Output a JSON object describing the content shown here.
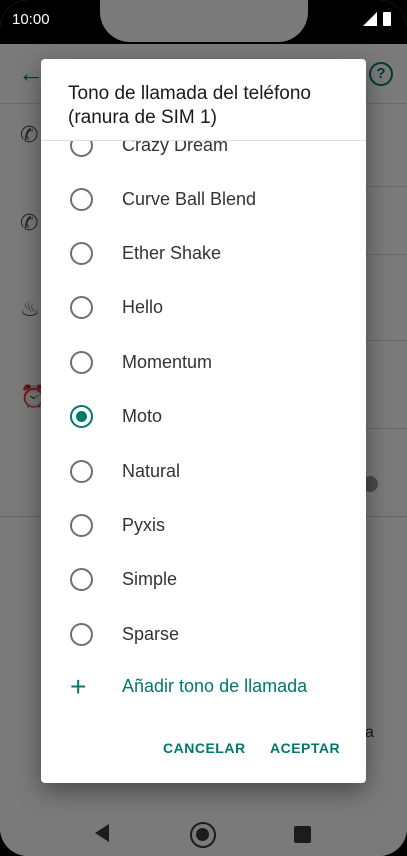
{
  "status_bar": {
    "time": "10:00"
  },
  "background_app": {
    "help_icon_text": "?",
    "trailing_text": "a"
  },
  "dialog": {
    "title": "Tono de llamada del teléfono (ranura de SIM 1)",
    "options": [
      {
        "label": "Crazy Dream",
        "checked": false
      },
      {
        "label": "Curve Ball Blend",
        "checked": false
      },
      {
        "label": "Ether Shake",
        "checked": false
      },
      {
        "label": "Hello",
        "checked": false
      },
      {
        "label": "Momentum",
        "checked": false
      },
      {
        "label": "Moto",
        "checked": true
      },
      {
        "label": "Natural",
        "checked": false
      },
      {
        "label": "Pyxis",
        "checked": false
      },
      {
        "label": "Simple",
        "checked": false
      },
      {
        "label": "Sparse",
        "checked": false
      }
    ],
    "add_label": "Añadir tono de llamada",
    "cancel_label": "CANCELAR",
    "accept_label": "ACEPTAR"
  },
  "colors": {
    "accent": "#00796b",
    "scrim": "rgba(0,0,0,0.52)"
  }
}
